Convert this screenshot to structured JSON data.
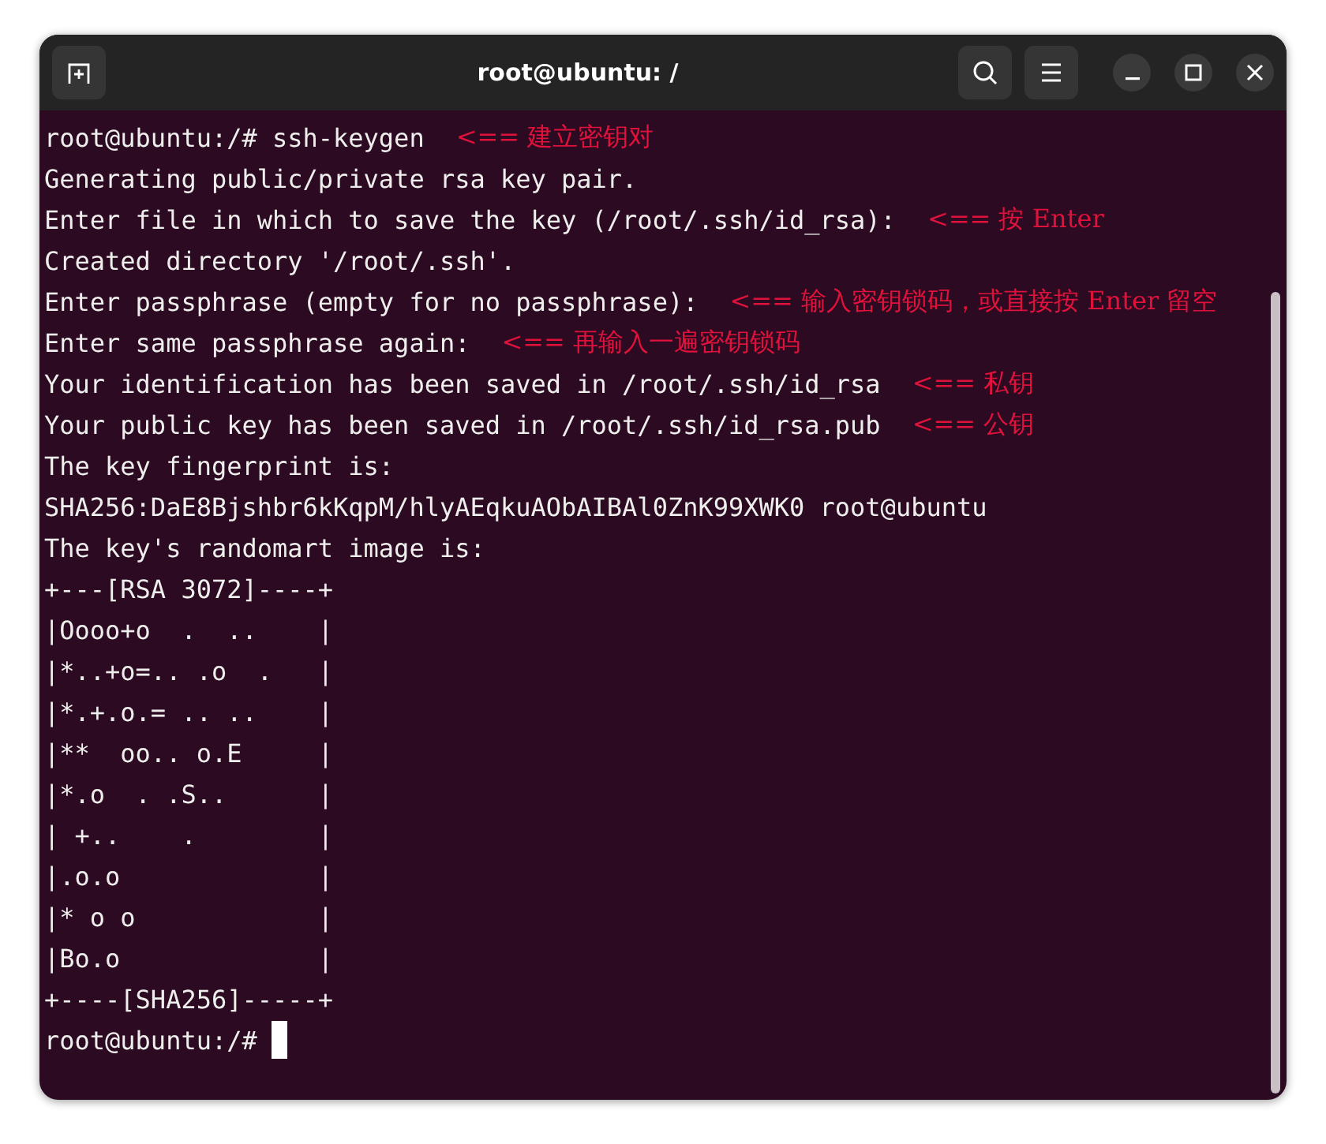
{
  "window": {
    "title": "root@ubuntu: /"
  },
  "terminal": {
    "lines": [
      {
        "text": "root@ubuntu:/# ssh-keygen",
        "note": "<== 建立密钥对"
      },
      {
        "text": "Generating public/private rsa key pair."
      },
      {
        "text": "Enter file in which to save the key (/root/.ssh/id_rsa):",
        "note": "<== 按 Enter"
      },
      {
        "text": "Created directory '/root/.ssh'."
      },
      {
        "text": "Enter passphrase (empty for no passphrase):",
        "note": "<== 输入密钥锁码，或直接按 Enter 留空"
      },
      {
        "text": "Enter same passphrase again:",
        "note": "<== 再输入一遍密钥锁码"
      },
      {
        "text": "Your identification has been saved in /root/.ssh/id_rsa",
        "note": "<== 私钥"
      },
      {
        "text": "Your public key has been saved in /root/.ssh/id_rsa.pub",
        "note": "<== 公钥"
      },
      {
        "text": "The key fingerprint is:"
      },
      {
        "text": "SHA256:DaE8Bjshbr6kKqpM/hlyAEqkuAObAIBAl0ZnK99XWK0 root@ubuntu"
      },
      {
        "text": "The key's randomart image is:"
      },
      {
        "text": "+---[RSA 3072]----+"
      },
      {
        "text": "|Oooo+o  .  ..    |"
      },
      {
        "text": "|*..+o=.. .o  .   |"
      },
      {
        "text": "|*.+.o.= .. ..    |"
      },
      {
        "text": "|**  oo.. o.E     |"
      },
      {
        "text": "|*.o  . .S..      |"
      },
      {
        "text": "| +..    .        |"
      },
      {
        "text": "|.o.o             |"
      },
      {
        "text": "|* o o            |"
      },
      {
        "text": "|Bo.o             |"
      },
      {
        "text": "+----[SHA256]-----+"
      },
      {
        "text": "root@ubuntu:/#",
        "cursor": true
      }
    ]
  }
}
